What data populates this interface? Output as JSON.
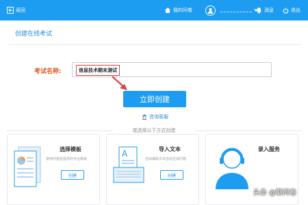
{
  "topbar": {
    "back_label": "返回",
    "my_questionnaire": "我的问卷",
    "messages": "消息",
    "logout": "退出"
  },
  "page": {
    "title": "创建在线考试",
    "exam_name_label": "考试名称:",
    "exam_name_value": "信息技术期末测试",
    "create_button": "立即创建",
    "support_link": "咨询客服",
    "or_text": "或选择以下方式创建"
  },
  "cards": [
    {
      "title": "选择模板",
      "desc": "使用问卷星提供的专业模板",
      "button": "创建"
    },
    {
      "title": "导入文本",
      "desc": "自由编辑文本自动生成问卷",
      "button": "创建"
    },
    {
      "title": "录入服务",
      "desc": "",
      "button": ""
    }
  ],
  "watermark": "头条 @聊问卷",
  "colors": {
    "primary": "#1d9df2",
    "highlight": "#e0403a",
    "label": "#e0561c"
  }
}
